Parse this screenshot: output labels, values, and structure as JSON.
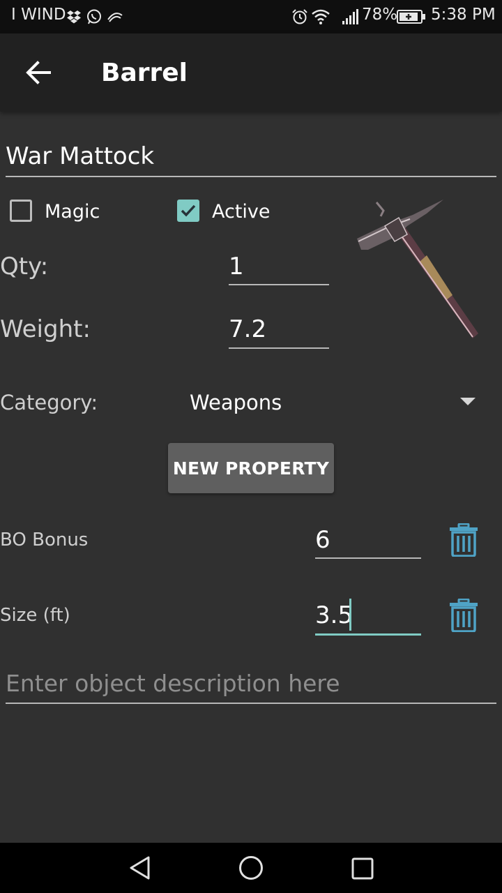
{
  "status_bar": {
    "carrier": "I WIND",
    "battery_percent": "78%",
    "time": "5:38 PM"
  },
  "app_bar": {
    "title": "Barrel",
    "back_icon": "arrow-left-icon"
  },
  "item": {
    "name": "War Mattock",
    "image_label": "war mattock image",
    "magic": {
      "label": "Magic",
      "checked": false
    },
    "active": {
      "label": "Active",
      "checked": true
    },
    "qty": {
      "label": "Qty:",
      "value": "1"
    },
    "weight": {
      "label": "Weight:",
      "value": "7.2"
    },
    "category": {
      "label": "Category:",
      "value": "Weapons"
    }
  },
  "new_property_label": "NEW PROPERTY",
  "properties": [
    {
      "label": "BO Bonus",
      "value": "6"
    },
    {
      "label": "Size (ft)",
      "value": "3.5"
    }
  ],
  "description": {
    "placeholder": "Enter object description here",
    "value": ""
  },
  "colors": {
    "accent": "#80cbc4",
    "trash": "#4fa3c6",
    "background": "#303030",
    "app_bar": "#212121"
  }
}
